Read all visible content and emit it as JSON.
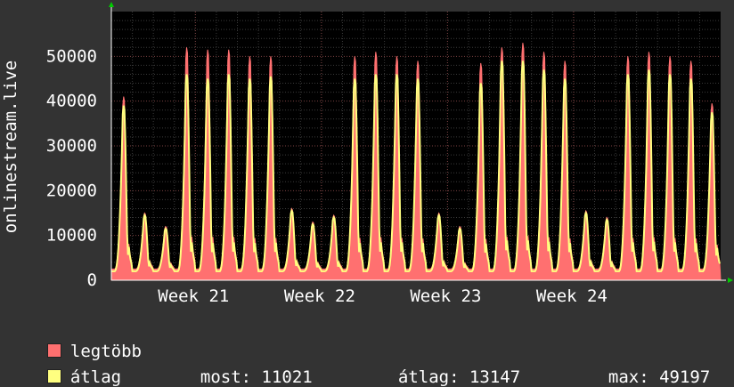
{
  "chart_data": {
    "type": "area",
    "title": "",
    "ylabel": "onlinestream.live",
    "xlabel": "",
    "ylim": [
      0,
      60000
    ],
    "yticks": [
      0,
      10000,
      20000,
      30000,
      40000,
      50000
    ],
    "ytick_labels": [
      "0",
      "10000",
      "20000",
      "30000",
      "40000",
      "50000"
    ],
    "xticks": [
      "Week 21",
      "Week 22",
      "Week 23",
      "Week 24"
    ],
    "grid": true,
    "days": 29,
    "series": [
      {
        "name": "legtöbb",
        "color": "#ff7070",
        "daily_peaks": [
          41000,
          15000,
          12000,
          52000,
          51500,
          51500,
          50000,
          50000,
          16000,
          13000,
          14500,
          50000,
          51000,
          50000,
          49000,
          15000,
          12000,
          48500,
          52000,
          53000,
          51000,
          49000,
          15500,
          14000,
          50000,
          51000,
          50000,
          49000,
          39500,
          15000
        ]
      },
      {
        "name": "átlag",
        "color": "#ffff80",
        "daily_peaks": [
          39000,
          14500,
          11500,
          46000,
          45000,
          46000,
          45000,
          45500,
          15500,
          12500,
          14000,
          45000,
          46000,
          46000,
          45000,
          14500,
          11500,
          44000,
          49000,
          49000,
          47000,
          45000,
          15000,
          13500,
          46000,
          47000,
          46000,
          45000,
          37500,
          14500
        ]
      }
    ]
  },
  "legend": {
    "max_label": "legtöbb",
    "avg_label": "átlag",
    "stats": {
      "now": "most: 11021",
      "avg": "átlag: 13147",
      "max": "max: 49197"
    },
    "colors": {
      "max": "#ff7070",
      "avg": "#ffff80"
    }
  }
}
